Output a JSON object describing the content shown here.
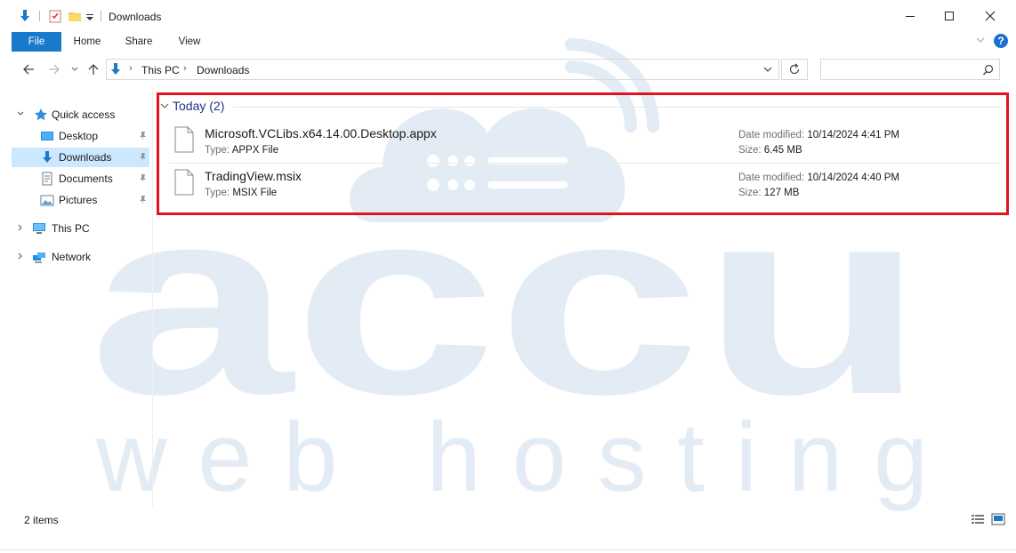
{
  "window": {
    "title": "Downloads"
  },
  "ribbon": {
    "tabs": [
      "File",
      "Home",
      "Share",
      "View"
    ],
    "help_label": "?"
  },
  "address": {
    "crumbs": [
      "This PC",
      "Downloads"
    ]
  },
  "search": {
    "placeholder": ""
  },
  "sidebar": {
    "quick_access": "Quick access",
    "items": [
      "Desktop",
      "Downloads",
      "Documents",
      "Pictures"
    ],
    "this_pc": "This PC",
    "network": "Network"
  },
  "content": {
    "group_header": "Today (2)",
    "type_label": "Type:",
    "date_label": "Date modified:",
    "size_label": "Size:",
    "files": [
      {
        "name": "Microsoft.VCLibs.x64.14.00.Desktop.appx",
        "type": "APPX File",
        "date": "10/14/2024 4:41 PM",
        "size": "6.45 MB"
      },
      {
        "name": "TradingView.msix",
        "type": "MSIX File",
        "date": "10/14/2024 4:40 PM",
        "size": "127 MB"
      }
    ]
  },
  "status": {
    "count": "2 items"
  },
  "watermark": {
    "brand": "accu",
    "tagline": "web hosting"
  },
  "colors": {
    "accent": "#1979ca",
    "highlight": "#e1141e",
    "selected": "#cce8ff",
    "group": "#1e3287"
  }
}
